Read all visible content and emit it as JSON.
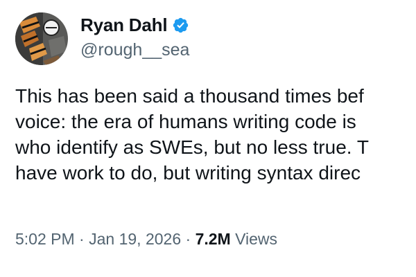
{
  "author": {
    "display_name": "Ryan Dahl",
    "handle": "@rough__sea",
    "verified_badge_icon": "verified-badge-icon",
    "verified_color": "#1d9bf0"
  },
  "tweet": {
    "lines": [
      "This has been said a thousand times bef",
      "voice: the era of humans writing code is",
      "who identify as SWEs, but no less true. T",
      "have work to do, but writing syntax direc"
    ]
  },
  "meta": {
    "time": "5:02 PM",
    "separator": "·",
    "date": "Jan 19, 2026",
    "views_count": "7.2M",
    "views_label": "Views"
  },
  "colors": {
    "text_primary": "#0f1419",
    "text_secondary": "#536471",
    "background": "#ffffff"
  }
}
